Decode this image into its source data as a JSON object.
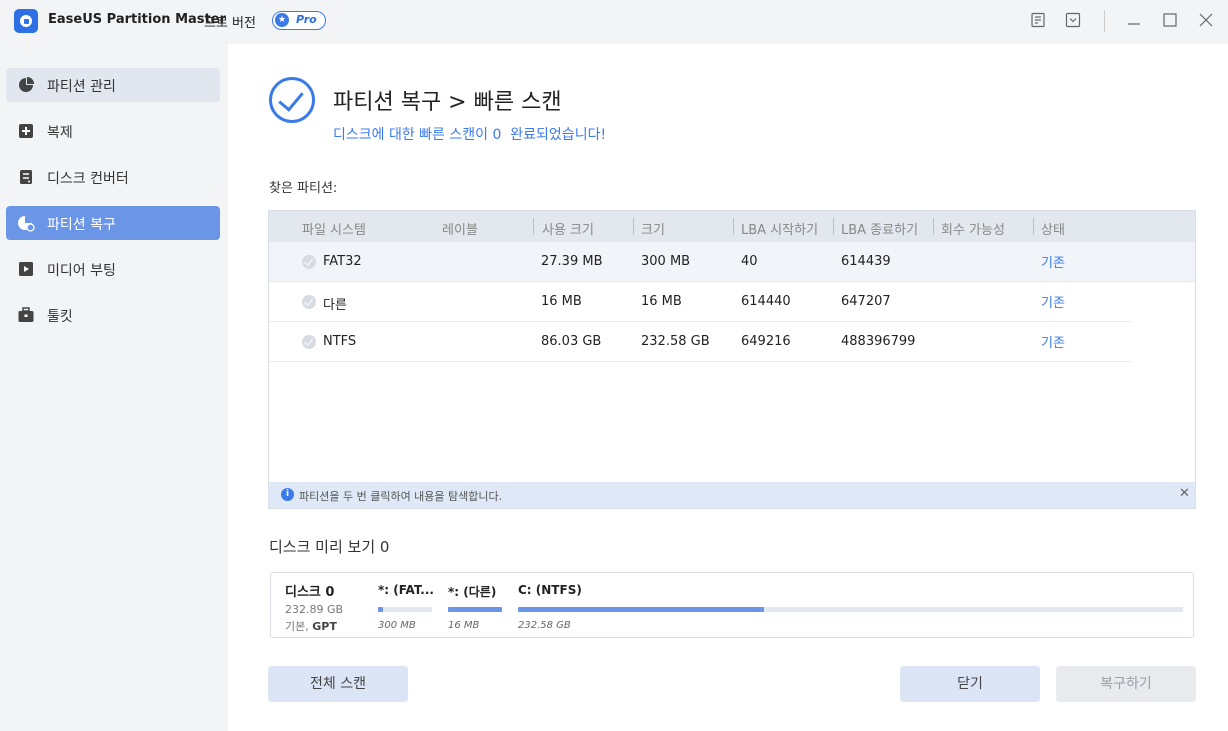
{
  "titlebar": {
    "app_name": "EaseUS Partition Master",
    "edition": "프로 버전",
    "badge": "Pro"
  },
  "sidebar": {
    "items": [
      {
        "label": "파티션 관리",
        "icon": "pie-chart-icon",
        "state": "hover"
      },
      {
        "label": "복제",
        "icon": "clone-plus-icon",
        "state": "normal"
      },
      {
        "label": "디스크 컨버터",
        "icon": "disk-convert-icon",
        "state": "normal"
      },
      {
        "label": "파티션 복구",
        "icon": "partition-recovery-icon",
        "state": "active"
      },
      {
        "label": "미디어 부팅",
        "icon": "media-boot-icon",
        "state": "normal"
      },
      {
        "label": "툴킷",
        "icon": "toolbox-icon",
        "state": "normal"
      }
    ]
  },
  "main": {
    "title": "파티션 복구 > 빠른 스캔",
    "subtitle": "디스크에 대한 빠른 스캔이 0  완료되었습니다!",
    "found_label": "찾은 파티션:",
    "table": {
      "columns": [
        "파일 시스템",
        "레이블",
        "사용 크기",
        "크기",
        "LBA 시작하기",
        "LBA 종료하기",
        "회수 가능성",
        "상태"
      ],
      "rows": [
        {
          "fs": "FAT32",
          "label": "",
          "used": "27.39 MB",
          "size": "300 MB",
          "lba_start": "40",
          "lba_end": "614439",
          "recoverability": "",
          "status": "기존"
        },
        {
          "fs": "다른",
          "label": "",
          "used": "16 MB",
          "size": "16 MB",
          "lba_start": "614440",
          "lba_end": "647207",
          "recoverability": "",
          "status": "기존"
        },
        {
          "fs": "NTFS",
          "label": "",
          "used": "86.03 GB",
          "size": "232.58 GB",
          "lba_start": "649216",
          "lba_end": "488396799",
          "recoverability": "",
          "status": "기존"
        }
      ]
    },
    "info_text": "파티션을 두 번 클릭하여 내용을 탐색합니다.",
    "disk_preview_label": "디스크 미리 보기 0",
    "disk": {
      "name": "디스크 0",
      "size": "232.89 GB",
      "type_prefix": "기본, ",
      "type_bold": "GPT",
      "partitions": [
        {
          "name": "*: (FAT...",
          "size": "300 MB",
          "used_fraction": 0.09
        },
        {
          "name": "*: (다른)",
          "size": "16 MB",
          "used_fraction": 1.0
        },
        {
          "name": "C: (NTFS)",
          "size": "232.58 GB",
          "used_fraction": 0.37
        }
      ]
    },
    "buttons": {
      "full_scan": "전체 스캔",
      "close": "닫기",
      "recover": "복구하기"
    }
  },
  "colors": {
    "accent": "#3b7be8",
    "active_nav": "#6b95e6",
    "sidebar_bg": "#f3f4f6"
  }
}
